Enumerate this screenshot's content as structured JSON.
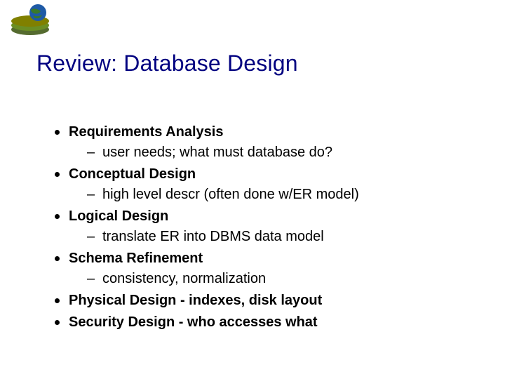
{
  "title": "Review: Database Design",
  "bullets": [
    {
      "label": "Requirements Analysis",
      "sub": "user needs; what must database do?"
    },
    {
      "label": "Conceptual Design",
      "sub": "high level descr (often done w/ER model)"
    },
    {
      "label": "Logical Design",
      "sub": "translate ER into DBMS data model"
    },
    {
      "label": "Schema Refinement",
      "sub": "consistency, normalization"
    },
    {
      "label": "Physical Design - indexes, disk layout"
    },
    {
      "label": "Security Design - who accesses what"
    }
  ]
}
